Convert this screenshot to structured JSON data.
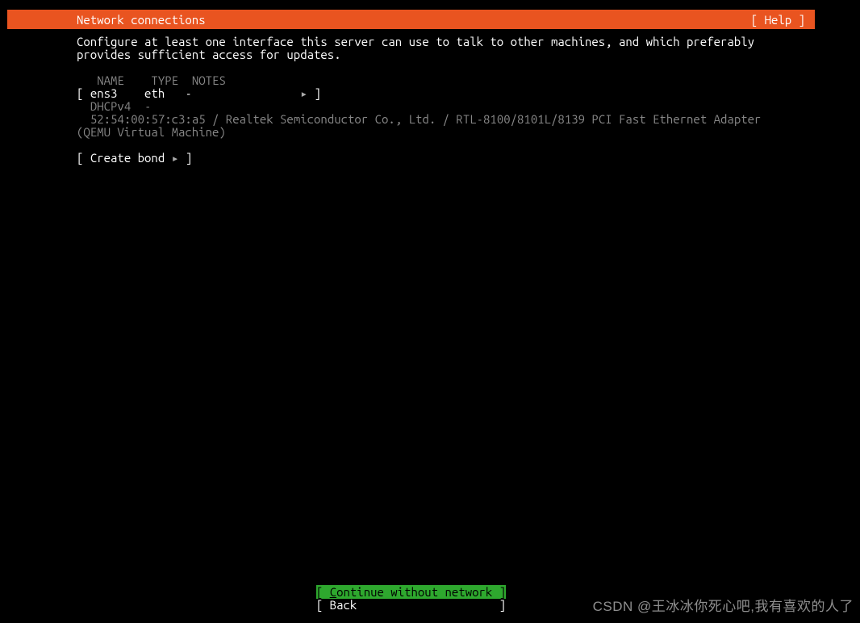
{
  "header": {
    "title": "Network connections",
    "help_label": "[ Help ]"
  },
  "description": {
    "line1": "Configure at least one interface this server can use to talk to other machines, and which preferably",
    "line2": "provides sufficient access for updates."
  },
  "table_headers": {
    "name": "NAME",
    "type": "TYPE",
    "notes": "NOTES"
  },
  "interface": {
    "bracket_open": "[ ",
    "name": "ens3",
    "type": "eth",
    "notes": "-",
    "triangle": "▸",
    "bracket_close": " ]",
    "dhcp_label": "DHCPv4",
    "dhcp_value": "-",
    "hw_info": "52:54:00:57:c3:a5 / Realtek Semiconductor Co., Ltd. / RTL-8100/8101L/8139 PCI Fast Ethernet Adapter",
    "vm_info": "(QEMU Virtual Machine)"
  },
  "create_bond": {
    "bracket_open": "[ ",
    "label": "Create bond",
    "triangle": "▸",
    "bracket_close": " ]"
  },
  "buttons": {
    "continue_open": "[ ",
    "continue_first_char": "C",
    "continue_rest": "ontinue without network",
    "continue_close": " ]",
    "back_open": "[ ",
    "back_label": "Back",
    "back_close": "                     ]"
  },
  "watermark": "CSDN @王冰冰你死心吧,我有喜欢的人了"
}
